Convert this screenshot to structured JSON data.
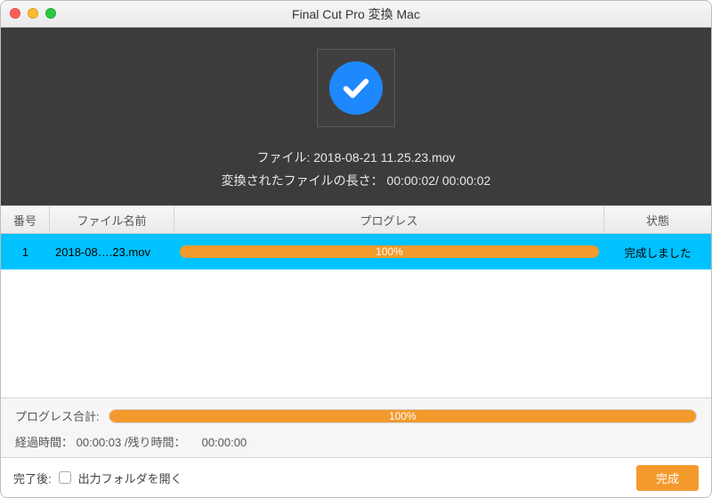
{
  "window": {
    "title": "Final Cut Pro 変換 Mac"
  },
  "hero": {
    "file_label": "ファイル:",
    "file_name": "2018-08-21 11.25.23.mov",
    "length_label": "変換されたファイルの長さ：",
    "length_value": "00:00:02/ 00:00:02"
  },
  "columns": {
    "index": "番号",
    "name": "ファイル名前",
    "progress": "プログレス",
    "status": "状態"
  },
  "rows": [
    {
      "index": "1",
      "name": "2018-08….23.mov",
      "progress_pct": 100,
      "progress_text": "100%",
      "status": "完成しました"
    }
  ],
  "summary": {
    "total_label": "プログレス合計:",
    "total_pct": 100,
    "total_text": "100%",
    "elapsed_label": "経過時間：",
    "elapsed_value": "00:00:03",
    "remain_label": "/残り時間：",
    "remain_value": "00:00:00"
  },
  "footer": {
    "after_label": "完了後:",
    "open_folder_label": "出力フォルダを開く",
    "open_folder_checked": false,
    "done_button": "完成"
  },
  "colors": {
    "accent": "#f39a2d",
    "check_bg": "#1e88ff",
    "row_selected": "#00c2ff"
  }
}
